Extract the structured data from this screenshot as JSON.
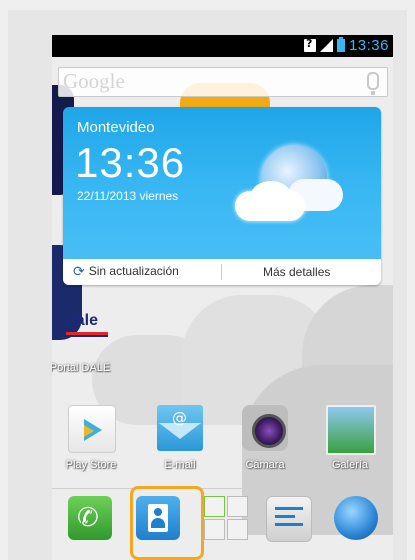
{
  "status_bar": {
    "time": "13:36",
    "icons": [
      "unknown-sim-icon",
      "signal-icon",
      "battery-icon"
    ]
  },
  "search": {
    "logo_text": "Google",
    "icons": [
      "mic-icon"
    ]
  },
  "weather_widget": {
    "city": "Montevideo",
    "time": "13:36",
    "date": "22/11/2013  viernes",
    "sync_label": "Sin actualización",
    "details_label": "Más detalles",
    "icons": [
      "weather-partly-cloudy-icon",
      "sync-icon"
    ]
  },
  "apps": {
    "dale_label": "Portal DALE",
    "dale_logo_text": "dale",
    "row": [
      {
        "label": "Play Store",
        "icon": "play-store-icon"
      },
      {
        "label": "E-mail",
        "icon": "email-icon"
      },
      {
        "label": "Cámara",
        "icon": "camera-icon"
      },
      {
        "label": "Galería",
        "icon": "gallery-icon"
      }
    ],
    "email_symbol": "@"
  },
  "dock": {
    "items": [
      "phone-icon",
      "contacts-icon",
      "apps-grid-icon",
      "messaging-icon",
      "browser-icon"
    ],
    "highlighted": "contacts-icon",
    "highlight_color": "#f5a623"
  },
  "colors": {
    "accent": "#39b6f0",
    "weather_bg": "#2fb0ef"
  }
}
